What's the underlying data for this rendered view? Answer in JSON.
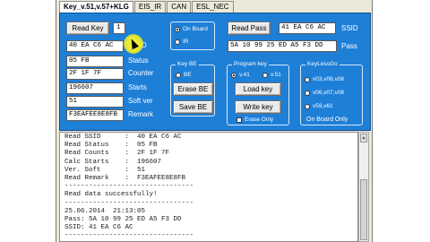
{
  "tabs": [
    "Key_v.51,v.57+KLG",
    "EIS_IR",
    "CAN",
    "ESL_NEC"
  ],
  "left": {
    "read_key_label": "Read Key",
    "key_index": "1",
    "ssid_value": "40 EA C6 AC",
    "ssid_label": "SSID",
    "status_value": "05 FB",
    "status_label": "Status",
    "counter_value": "2F 1F 7F",
    "counter_label": "Counter",
    "starts_value": "196607",
    "starts_label": "Starts",
    "softver_value": "51",
    "softver_label": "Soft ver",
    "remark_value": "F3EAFEE8E8FB",
    "remark_label": "Remark"
  },
  "mode": {
    "on_board": "On Board",
    "ir": "IR"
  },
  "key_be": {
    "title": "Key BE",
    "option": "BE",
    "erase": "Erase BE",
    "save": "Save BE"
  },
  "program_key": {
    "title": "Program key",
    "v41": "v.41",
    "v51": "v.51",
    "load": "Load key",
    "write": "Write key",
    "erase_only": "Erase Only"
  },
  "right": {
    "read_pass_label": "Read Pass",
    "ssid_value": "41 EA C6 AC",
    "ssid_label": "SSID",
    "pass_value": "5A 10 99 25 ED A5 F3 DD",
    "pass_label": "Pass"
  },
  "keyless": {
    "title": "KeyLessGo",
    "opt1": "v03,v06,v08",
    "opt2": "v06,v07,v08",
    "opt3": "v59,v61",
    "on_board": "On Board Only"
  },
  "log": [
    "Read SSID      :  40 EA C6 AC",
    "Read Status    :  05 FB",
    "Read Counts    :  2F 1F 7F",
    "Calc Starts    :  196607",
    "Ver. Soft      :  51",
    "Read Remark    :  F3EAFEE8E8FB",
    "--------------------------------",
    "Read data successfully!",
    "--------------------------------",
    "25.06.2014  21:13:05",
    "Pass: 5A 10 99 25 ED A5 F3 DD",
    "SSID: 41 EA C6 AC",
    "--------------------------------"
  ]
}
